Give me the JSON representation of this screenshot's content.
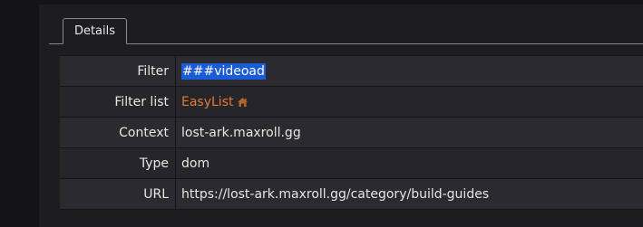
{
  "tabs": [
    {
      "label": "Details",
      "active": true
    }
  ],
  "details": {
    "filter": {
      "label": "Filter",
      "value": "###videoad"
    },
    "filter_list": {
      "label": "Filter list",
      "value": "EasyList",
      "icon": "home-icon"
    },
    "context": {
      "label": "Context",
      "value": "lost-ark.maxroll.gg"
    },
    "type": {
      "label": "Type",
      "value": "dom"
    },
    "url": {
      "label": "URL",
      "value": "https://lost-ark.maxroll.gg/category/build-guides"
    }
  },
  "colors": {
    "link": "#e07a36",
    "selection": "#1a5cd7"
  }
}
